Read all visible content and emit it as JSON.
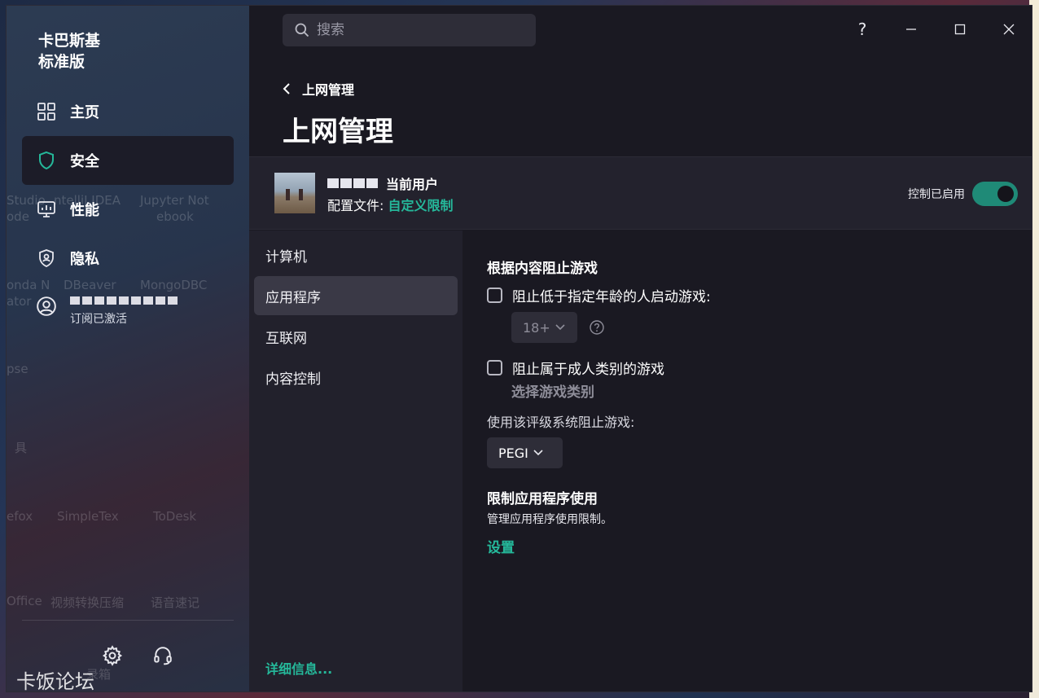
{
  "sidebar": {
    "brand_line1": "卡巴斯基",
    "brand_line2": "标准版",
    "items": [
      {
        "label": "主页",
        "icon": "grid-icon"
      },
      {
        "label": "安全",
        "icon": "shield-icon"
      },
      {
        "label": "性能",
        "icon": "monitor-icon"
      },
      {
        "label": "隐私",
        "icon": "lock-shield-icon"
      }
    ],
    "account": {
      "subscription": "订阅已激活",
      "icon": "user-circle-icon"
    },
    "bottom": {
      "settings_icon": "gear-icon",
      "support_icon": "headset-icon"
    }
  },
  "desktop_ghosts": [
    "Studio",
    "ode",
    "ntelliJ IDEA",
    "Jupyter Not",
    "ebook",
    "onda N",
    "ator",
    "DBeaver",
    "MongoDBC",
    "pse",
    "具",
    "efox",
    "SimpleTex",
    "ToDesk",
    "Office",
    "视频转换压缩",
    "语音速记",
    "录箱"
  ],
  "watermark": "卡饭论坛",
  "search": {
    "placeholder": "搜索"
  },
  "window_controls": {
    "help": "?"
  },
  "breadcrumb": "上网管理",
  "page_title": "上网管理",
  "user": {
    "name_suffix": "当前用户",
    "profile_label": "配置文件:",
    "profile_value": "自定义限制",
    "control_label": "控制已启用",
    "control_enabled": true
  },
  "subnav": {
    "items": [
      "计算机",
      "应用程序",
      "互联网",
      "内容控制"
    ],
    "active": 1,
    "details_link": "详细信息..."
  },
  "content": {
    "section1_title": "根据内容阻止游戏",
    "check_age": "阻止低于指定年龄的人启动游戏:",
    "age_value": "18+",
    "check_adult": "阻止属于成人类别的游戏",
    "choose_category": "选择游戏类别",
    "rating_label": "使用该评级系统阻止游戏:",
    "rating_value": "PEGI",
    "section2_title": "限制应用程序使用",
    "section2_desc": "管理应用程序使用限制。",
    "settings_link": "设置"
  },
  "colors": {
    "accent": "#25b89a",
    "toggle": "#1f8a77",
    "sidebar_active": "#1c1c28",
    "main_bg": "#1a1922"
  }
}
